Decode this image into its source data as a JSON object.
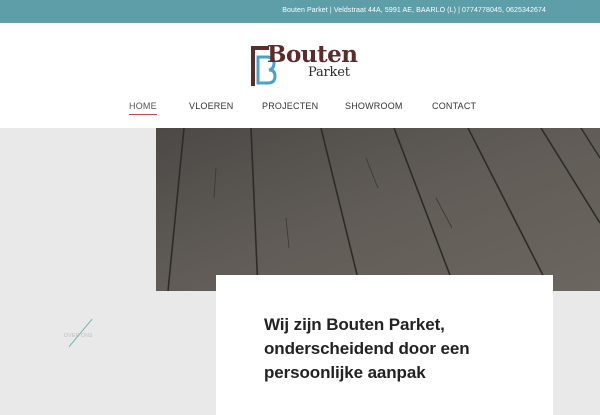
{
  "topbar": {
    "text": "Bouten Parket   |   Veldstraat 44A, 5991 AE, BAARLO (L)   |   0774778045, 0625342674"
  },
  "logo": {
    "word1": "Bouten",
    "word2": "Parket"
  },
  "nav": {
    "items": [
      {
        "label": "HOME"
      },
      {
        "label": "VLOEREN"
      },
      {
        "label": "PROJECTEN"
      },
      {
        "label": "SHOWROOM"
      },
      {
        "label": "CONTACT"
      }
    ]
  },
  "side": {
    "label": "OVER ONS"
  },
  "intro": {
    "title": "Wij zijn Bouten Parket, onderscheidend door een persoonlijke aanpak"
  },
  "colors": {
    "topbar": "#5e9ea8",
    "accent": "#c24848",
    "logo_brown": "#5a2d2d",
    "logo_blue": "#4aa3c4"
  }
}
